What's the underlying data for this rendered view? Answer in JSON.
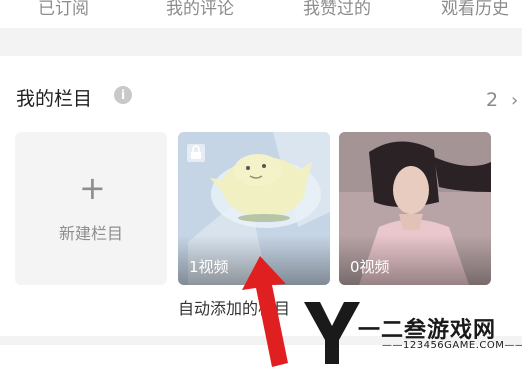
{
  "top_tabs": [
    {
      "label": "已订阅"
    },
    {
      "label": "我的评论"
    },
    {
      "label": "我赞过的"
    },
    {
      "label": "观看历史"
    }
  ],
  "section": {
    "title": "我的栏目",
    "count": "2",
    "info_icon": "info-icon",
    "more_icon": "chevron-right-icon"
  },
  "tiles": [
    {
      "label": "新建栏目",
      "icon": "plus-icon"
    },
    {
      "video_count": "1视频",
      "title": "自动添加的栏目",
      "icon": "lock-icon"
    },
    {
      "video_count": "0视频",
      "title": ""
    }
  ],
  "watermark": {
    "brand": "一二叁游戏网",
    "url": "——123456GAME.COM——"
  },
  "colors": {
    "accent_arrow": "#e02020",
    "page_bg": "#f3f3f3"
  }
}
